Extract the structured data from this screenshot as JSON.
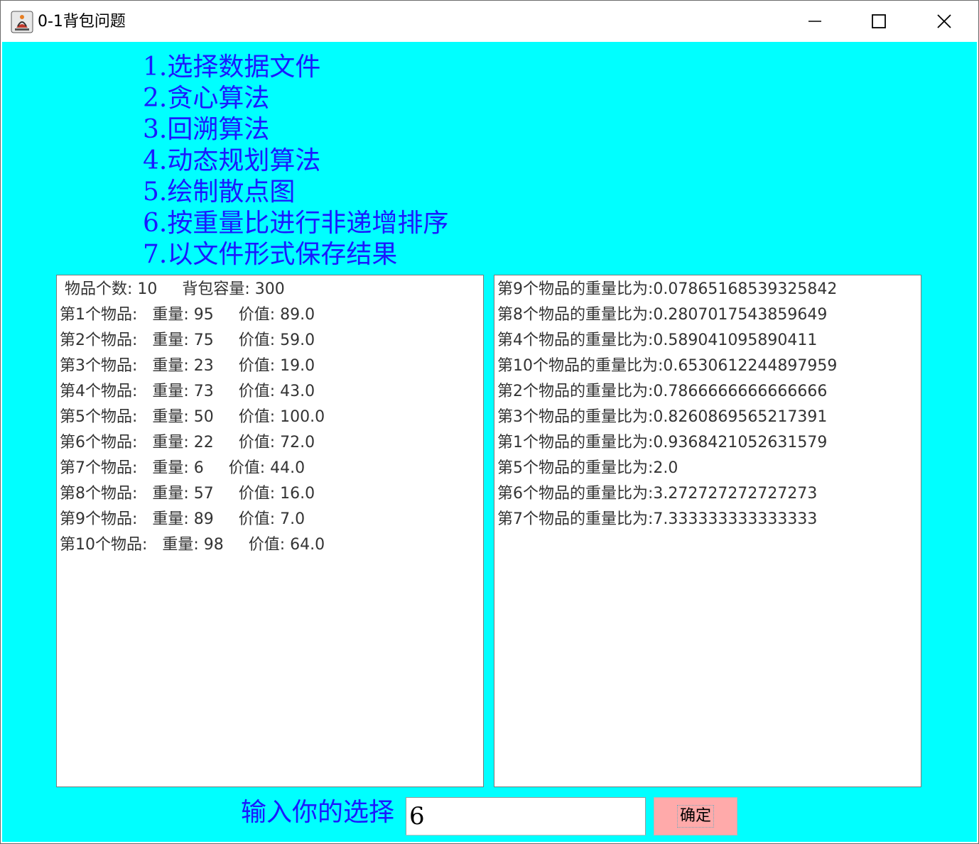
{
  "window": {
    "title": "0-1背包问题"
  },
  "menu": {
    "items": [
      "1.选择数据文件",
      "2.贪心算法",
      "3.回溯算法",
      "4.动态规划算法",
      "5.绘制散点图",
      "6.按重量比进行非递增排序",
      "7.以文件形式保存结果"
    ]
  },
  "left_panel": {
    "lines": [
      " 物品个数: 10     背包容量: 300",
      "第1个物品:   重量: 95     价值: 89.0",
      "第2个物品:   重量: 75     价值: 59.0",
      "第3个物品:   重量: 23     价值: 19.0",
      "第4个物品:   重量: 73     价值: 43.0",
      "第5个物品:   重量: 50     价值: 100.0",
      "第6个物品:   重量: 22     价值: 72.0",
      "第7个物品:   重量: 6     价值: 44.0",
      "第8个物品:   重量: 57     价值: 16.0",
      "第9个物品:   重量: 89     价值: 7.0",
      "第10个物品:   重量: 98     价值: 64.0"
    ]
  },
  "right_panel": {
    "lines": [
      "第9个物品的重量比为:0.07865168539325842",
      "第8个物品的重量比为:0.2807017543859649",
      "第4个物品的重量比为:0.589041095890411",
      "第10个物品的重量比为:0.6530612244897959",
      "第2个物品的重量比为:0.7866666666666666",
      "第3个物品的重量比为:0.8260869565217391",
      "第1个物品的重量比为:0.9368421052631579",
      "第5个物品的重量比为:2.0",
      "第6个物品的重量比为:3.272727272727273",
      "第7个物品的重量比为:7.333333333333333"
    ]
  },
  "input_row": {
    "label": "输入你的选择",
    "value": "6",
    "button_label": "确定"
  },
  "colors": {
    "client_background": "#00ffff",
    "menu_text": "#1a1aff",
    "button_background": "#ffaaaa"
  }
}
